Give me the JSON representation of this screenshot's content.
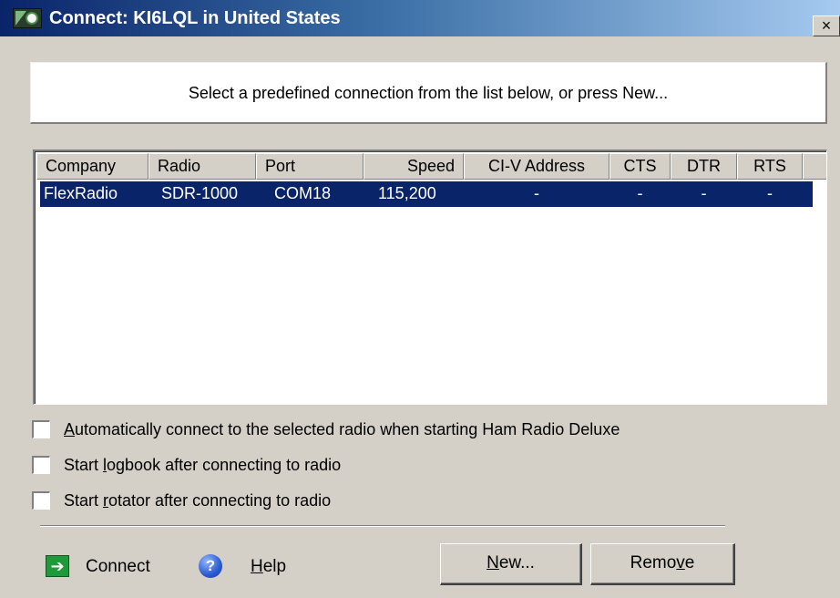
{
  "window": {
    "title": "Connect: KI6LQL in United States",
    "close_glyph": "×"
  },
  "instruction": "Select a predefined connection from the list below, or press New...",
  "columns": [
    "Company",
    "Radio",
    "Port",
    "Speed",
    "CI-V Address",
    "CTS",
    "DTR",
    "RTS"
  ],
  "rows": [
    {
      "company": "FlexRadio",
      "radio": "SDR-1000",
      "port": "COM18",
      "speed": "115,200",
      "civ_address": "-",
      "cts": "-",
      "dtr": "-",
      "rts": "-",
      "selected": true
    }
  ],
  "options": [
    {
      "pre": "",
      "accel": "A",
      "post": "utomatically connect to the selected radio when starting Ham Radio Deluxe",
      "checked": false
    },
    {
      "pre": "Start ",
      "accel": "l",
      "post": "ogbook after connecting to radio",
      "checked": false
    },
    {
      "pre": "Start ",
      "accel": "r",
      "post": "otator after connecting to radio",
      "checked": false
    }
  ],
  "footer": {
    "connect_label": "Connect",
    "connect_icon": "green-arrow-icon",
    "help_accel": "H",
    "help_rest": "elp",
    "help_icon": "question-mark-icon",
    "new_accel": "N",
    "new_rest": "ew...",
    "remove_pre": "Remo",
    "remove_accel": "v",
    "remove_post": "e"
  },
  "colors": {
    "title_bar_start": "#0a246a",
    "title_bar_end": "#a6caf0",
    "selection": "#0a246a",
    "dialog_bg": "#d4d0c8"
  }
}
